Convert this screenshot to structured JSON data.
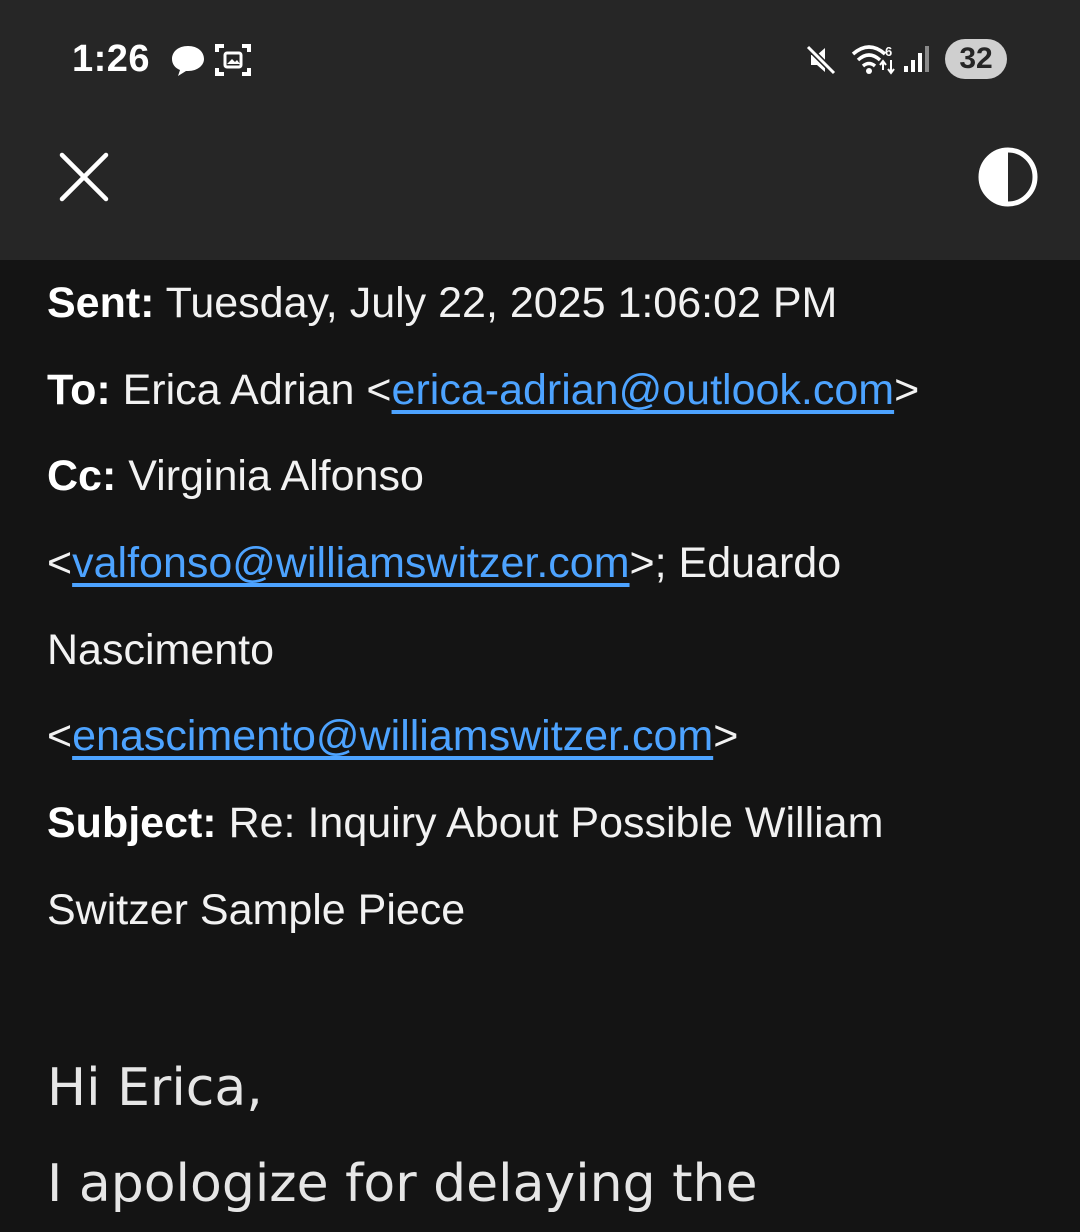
{
  "status_bar": {
    "time": "1:26",
    "icons": [
      "chat-bubble-icon",
      "screenshot-icon",
      "mute-icon",
      "wifi-6-icon",
      "signal-icon"
    ],
    "battery": "32"
  },
  "toolbar": {
    "close_icon": "close-icon",
    "theme_icon": "contrast-icon"
  },
  "email": {
    "sent_label": "Sent:",
    "sent_value": "Tuesday, July 22, 2025 1:06:02 PM",
    "to_label": "To:",
    "to_name": "Erica Adrian",
    "to_email": "erica-adrian@outlook.com",
    "cc_label": "Cc:",
    "cc1_name": "Virginia Alfonso",
    "cc1_email": "valfonso@williamswitzer.com",
    "cc2_name_part1": "Eduardo",
    "cc2_name_part2": "Nascimento",
    "cc2_email": "enascimento@williamswitzer.com",
    "subject_label": "Subject:",
    "subject_part1": "Re: Inquiry About Possible William",
    "subject_part2": "Switzer Sample Piece",
    "greeting": "Hi Erica,",
    "body_start": "I apologize for delaying the"
  },
  "colors": {
    "background": "#141414",
    "bar": "#262626",
    "link": "#4da3ff"
  }
}
